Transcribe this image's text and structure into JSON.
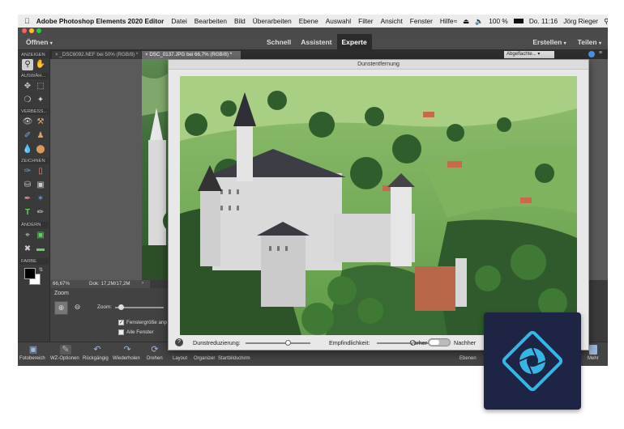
{
  "menubar": {
    "apple_icon": "apple-icon",
    "app_name": "Adobe Photoshop Elements 2020 Editor",
    "items": [
      "Datei",
      "Bearbeiten",
      "Bild",
      "Überarbeiten",
      "Ebene",
      "Auswahl",
      "Filter",
      "Ansicht",
      "Fenster",
      "Hilfe"
    ],
    "battery": "100 %",
    "clock": "Do. 11:16",
    "user": "Jörg Rieger"
  },
  "topbar": {
    "open_label": "Öffnen",
    "modes": [
      "Schnell",
      "Assistent",
      "Experte"
    ],
    "active_mode": "Experte",
    "create_label": "Erstellen",
    "share_label": "Teilen"
  },
  "toolbox": {
    "sections": [
      "ANZEIGEN",
      "AUSWÄH...",
      "VERBESS...",
      "ZEICHNEN",
      "ÄNDERN",
      "FARBE"
    ],
    "foreground_color": "#000000",
    "background_color": "#ffffff"
  },
  "tabs": [
    {
      "label": "_DSC6092.NEF bei 50% (RGB/8) *"
    },
    {
      "label": "DSC_0137.JPG bei 66,7% (RGB/8) *"
    }
  ],
  "layer_blend": "Abgeflachte...",
  "status": {
    "zoom": "66,67%",
    "doc": "Dok: 17,2M/17,2M"
  },
  "zoom_panel": {
    "title": "Zoom",
    "zoom_label": "Zoom:",
    "fit_window_label": "Fenstergröße anp",
    "all_windows_label": "Alle Fenster",
    "fit_window_checked": true
  },
  "taskbar": {
    "items": [
      "Fotobereich",
      "WZ-Optionen",
      "Rückgängig",
      "Wiederholen",
      "Drehen",
      "Layout",
      "Organizer",
      "Startbildschirm"
    ],
    "right_items": [
      "Ebenen",
      "Mehr"
    ]
  },
  "dialog": {
    "title": "Dunstentfernung",
    "haze_label": "Dunstreduzierung:",
    "haze_value": 0.65,
    "sensitivity_label": "Empfindlichkeit:",
    "sensitivity_value": 0.55,
    "before_label": "Vorher",
    "after_label": "Nachher",
    "help_icon": "help-icon"
  },
  "colors": {
    "accent_mode": "#2b2b2b",
    "logo_bg": "#1e2444",
    "logo_ring": "#35b6e6"
  }
}
